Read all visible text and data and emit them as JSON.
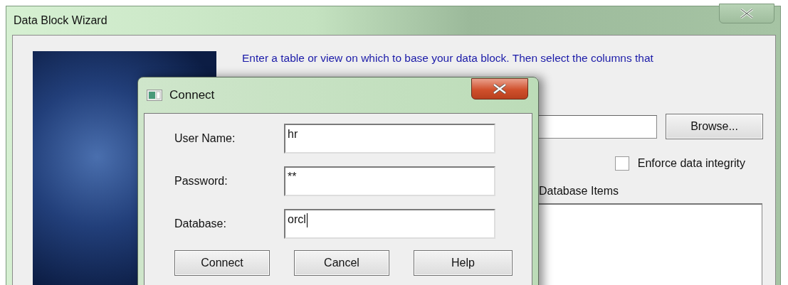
{
  "window": {
    "title": "Data Block Wizard"
  },
  "wizard": {
    "description": "Enter a table or view on which to base your data block. Then select the columns that",
    "browse_button": "Browse...",
    "enforce_integrity": {
      "label": "Enforce data integrity",
      "checked": false
    },
    "database_items_label": "Database Items"
  },
  "connect_dialog": {
    "title": "Connect",
    "fields": [
      {
        "label": "User Name:",
        "value": "hr",
        "focused": false
      },
      {
        "label": "Password:",
        "value": "**",
        "focused": false
      },
      {
        "label": "Database:",
        "value": "orcl",
        "focused": true
      }
    ],
    "buttons": [
      "Connect",
      "Cancel",
      "Help"
    ]
  }
}
